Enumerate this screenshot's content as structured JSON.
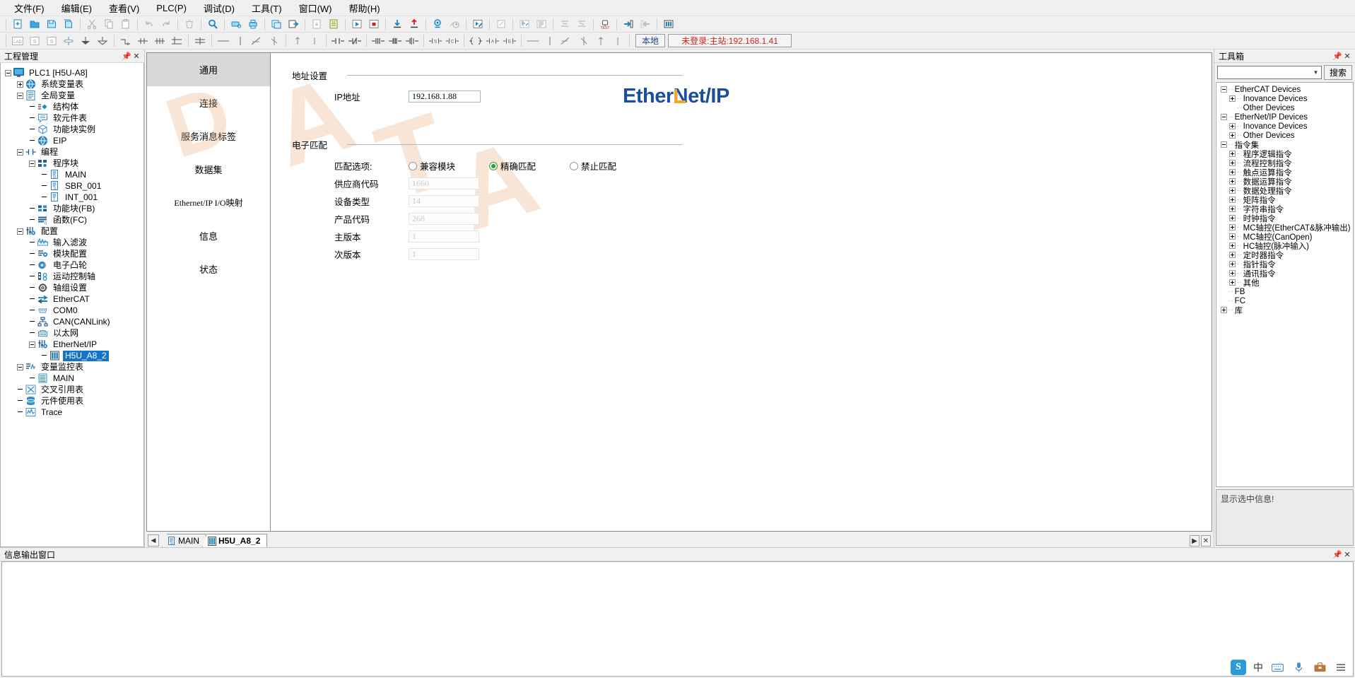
{
  "menubar": {
    "items": [
      {
        "label": "文件(F)",
        "name": "menu-file"
      },
      {
        "label": "编辑(E)",
        "name": "menu-edit"
      },
      {
        "label": "查看(V)",
        "name": "menu-view"
      },
      {
        "label": "PLC(P)",
        "name": "menu-plc"
      },
      {
        "label": "调试(D)",
        "name": "menu-debug"
      },
      {
        "label": "工具(T)",
        "name": "menu-tools"
      },
      {
        "label": "窗口(W)",
        "name": "menu-window"
      },
      {
        "label": "帮助(H)",
        "name": "menu-help"
      }
    ]
  },
  "statusbar": {
    "local_label": "本地",
    "connection_label": "未登录:主站:192.168.1.41"
  },
  "project_panel": {
    "title": "工程管理",
    "pin_icon": "pin-icon",
    "close_icon": "close-icon",
    "tree": [
      {
        "label": "PLC1 [H5U-A8]",
        "depth": 0,
        "twist": "minus",
        "icon": "plc-icon"
      },
      {
        "label": "系统变量表",
        "depth": 1,
        "twist": "plus",
        "icon": "globe-icon"
      },
      {
        "label": "全局变量",
        "depth": 1,
        "twist": "minus",
        "icon": "list-icon"
      },
      {
        "label": "结构体",
        "depth": 2,
        "twist": "none",
        "icon": "struct-icon"
      },
      {
        "label": "软元件表",
        "depth": 2,
        "twist": "none",
        "icon": "devtable-icon"
      },
      {
        "label": "功能块实例",
        "depth": 2,
        "twist": "none",
        "icon": "cube-icon"
      },
      {
        "label": "EIP",
        "depth": 2,
        "twist": "none",
        "icon": "globe-icon"
      },
      {
        "label": "编程",
        "depth": 1,
        "twist": "minus",
        "icon": "contact-icon"
      },
      {
        "label": "程序块",
        "depth": 2,
        "twist": "minus",
        "icon": "blocks-icon"
      },
      {
        "label": "MAIN",
        "depth": 3,
        "twist": "none",
        "icon": "prog-main-icon"
      },
      {
        "label": "SBR_001",
        "depth": 3,
        "twist": "none",
        "icon": "prog-sbr-icon"
      },
      {
        "label": "INT_001",
        "depth": 3,
        "twist": "none",
        "icon": "prog-int-icon"
      },
      {
        "label": "功能块(FB)",
        "depth": 2,
        "twist": "none",
        "icon": "fb-icon"
      },
      {
        "label": "函数(FC)",
        "depth": 2,
        "twist": "none",
        "icon": "fc-icon"
      },
      {
        "label": "配置",
        "depth": 1,
        "twist": "minus",
        "icon": "config-icon"
      },
      {
        "label": "输入滤波",
        "depth": 2,
        "twist": "none",
        "icon": "wave-icon"
      },
      {
        "label": "模块配置",
        "depth": 2,
        "twist": "none",
        "icon": "module-icon"
      },
      {
        "label": "电子凸轮",
        "depth": 2,
        "twist": "none",
        "icon": "cam-icon"
      },
      {
        "label": "运动控制轴",
        "depth": 2,
        "twist": "none",
        "icon": "axis-icon"
      },
      {
        "label": "轴组设置",
        "depth": 2,
        "twist": "none",
        "icon": "gear-icon"
      },
      {
        "label": "EtherCAT",
        "depth": 2,
        "twist": "none",
        "icon": "ethercat-icon"
      },
      {
        "label": "COM0",
        "depth": 2,
        "twist": "none",
        "icon": "serial-icon"
      },
      {
        "label": "CAN(CANLink)",
        "depth": 2,
        "twist": "none",
        "icon": "can-icon"
      },
      {
        "label": "以太网",
        "depth": 2,
        "twist": "none",
        "icon": "ethernet-icon"
      },
      {
        "label": "EtherNet/IP",
        "depth": 2,
        "twist": "minus",
        "icon": "config-icon"
      },
      {
        "label": "H5U_A8_2",
        "depth": 3,
        "twist": "none",
        "icon": "device-icon",
        "selected": true
      },
      {
        "label": "变量监控表",
        "depth": 1,
        "twist": "minus",
        "icon": "monitor-icon"
      },
      {
        "label": "MAIN",
        "depth": 2,
        "twist": "none",
        "icon": "table-icon"
      },
      {
        "label": "交叉引用表",
        "depth": 1,
        "twist": "none",
        "icon": "xref-icon"
      },
      {
        "label": "元件使用表",
        "depth": 1,
        "twist": "none",
        "icon": "db-icon"
      },
      {
        "label": "Trace",
        "depth": 1,
        "twist": "none",
        "icon": "trace-icon"
      }
    ]
  },
  "editor": {
    "side_tabs": [
      {
        "label": "通用",
        "name": "tab-general",
        "active": true
      },
      {
        "label": "连接",
        "name": "tab-connection",
        "active": false
      },
      {
        "label": "服务消息标签",
        "name": "tab-service-message-tag",
        "active": false
      },
      {
        "label": "数据集",
        "name": "tab-dataset",
        "active": false
      },
      {
        "label": "Ethernet/IP I/O映射",
        "name": "tab-io-mapping",
        "active": false,
        "mono": true
      },
      {
        "label": "信息",
        "name": "tab-info",
        "active": false
      },
      {
        "label": "状态",
        "name": "tab-status",
        "active": false
      }
    ],
    "address_section": {
      "title": "地址设置",
      "ip_label": "IP地址",
      "ip_value": "192.168.1.88"
    },
    "logo": {
      "text_a": "Ether",
      "text_n": "N",
      "text_b": "et/IP",
      "color": "#1a4fa0",
      "accent": "#f5a623"
    },
    "match_section": {
      "title": "电子匹配",
      "option_label": "匹配选项:",
      "options": [
        {
          "label": "兼容模块",
          "name": "radio-compatible-module",
          "checked": false
        },
        {
          "label": "精确匹配",
          "name": "radio-exact-match",
          "checked": true
        },
        {
          "label": "禁止匹配",
          "name": "radio-disable-match",
          "checked": false
        }
      ],
      "fields": [
        {
          "label": "供应商代码",
          "value": "1660",
          "name": "vendor-code-input"
        },
        {
          "label": "设备类型",
          "value": "14",
          "name": "device-type-input"
        },
        {
          "label": "产品代码",
          "value": "268",
          "name": "product-code-input"
        },
        {
          "label": "主版本",
          "value": "1",
          "name": "major-version-input"
        },
        {
          "label": "次版本",
          "value": "1",
          "name": "minor-version-input"
        }
      ]
    }
  },
  "doc_tabs": {
    "scroll_left_icon": "chevron-left-icon",
    "tabs": [
      {
        "label": "MAIN",
        "name": "doctab-main",
        "icon": "prog-main-icon",
        "active": false
      },
      {
        "label": "H5U_A8_2",
        "name": "doctab-h5u-a8-2",
        "icon": "device-icon",
        "active": true
      }
    ],
    "scroll_right_icon": "chevron-right-icon",
    "close_icon": "close-icon"
  },
  "toolbox": {
    "title": "工具箱",
    "pin_icon": "pin-icon",
    "close_icon": "close-icon",
    "search_value": "",
    "search_placeholder": "",
    "search_button": "搜索",
    "dropdown_icon": "chevron-down-icon",
    "info_text": "显示选中信息!",
    "tree": [
      {
        "label": "EtherCAT Devices",
        "depth": 0,
        "twist": "minus"
      },
      {
        "label": "Inovance Devices",
        "depth": 1,
        "twist": "plus"
      },
      {
        "label": "Other Devices",
        "depth": 1,
        "twist": "leaf"
      },
      {
        "label": "EtherNet/IP Devices",
        "depth": 0,
        "twist": "minus"
      },
      {
        "label": "Inovance Devices",
        "depth": 1,
        "twist": "plus"
      },
      {
        "label": "Other Devices",
        "depth": 1,
        "twist": "plus"
      },
      {
        "label": "指令集",
        "depth": 0,
        "twist": "minus"
      },
      {
        "label": "程序逻辑指令",
        "depth": 1,
        "twist": "plus"
      },
      {
        "label": "流程控制指令",
        "depth": 1,
        "twist": "plus"
      },
      {
        "label": "触点运算指令",
        "depth": 1,
        "twist": "plus"
      },
      {
        "label": "数据运算指令",
        "depth": 1,
        "twist": "plus"
      },
      {
        "label": "数据处理指令",
        "depth": 1,
        "twist": "plus"
      },
      {
        "label": "矩阵指令",
        "depth": 1,
        "twist": "plus"
      },
      {
        "label": "字符串指令",
        "depth": 1,
        "twist": "plus"
      },
      {
        "label": "时钟指令",
        "depth": 1,
        "twist": "plus"
      },
      {
        "label": "MC轴控(EtherCAT&脉冲输出)",
        "depth": 1,
        "twist": "plus"
      },
      {
        "label": "MC轴控(CanOpen)",
        "depth": 1,
        "twist": "plus"
      },
      {
        "label": "HC轴控(脉冲输入)",
        "depth": 1,
        "twist": "plus"
      },
      {
        "label": "定时器指令",
        "depth": 1,
        "twist": "plus"
      },
      {
        "label": "指针指令",
        "depth": 1,
        "twist": "plus"
      },
      {
        "label": "通讯指令",
        "depth": 1,
        "twist": "plus"
      },
      {
        "label": "其他",
        "depth": 1,
        "twist": "plus"
      },
      {
        "label": "FB",
        "depth": 0,
        "twist": "leaf"
      },
      {
        "label": "FC",
        "depth": 0,
        "twist": "leaf"
      },
      {
        "label": "库",
        "depth": 0,
        "twist": "plus"
      }
    ]
  },
  "output_panel": {
    "title": "信息输出窗口",
    "pin_icon": "pin-icon",
    "close_icon": "close-icon",
    "content": ""
  },
  "tray": {
    "ime_logo": "S",
    "lang_label": "中",
    "icons": [
      "keyboard-icon",
      "mic-icon",
      "toolbox-icon",
      "menu-icon"
    ]
  },
  "watermark": {
    "text": "DATA",
    "color": "#eca878"
  }
}
